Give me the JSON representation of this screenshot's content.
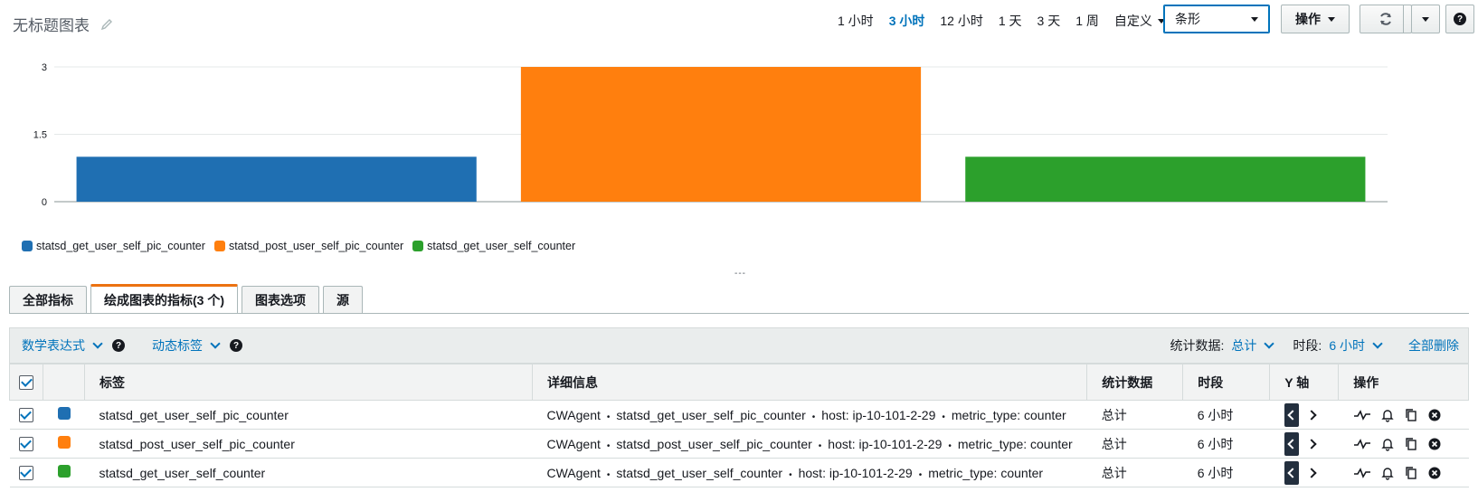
{
  "header": {
    "title": "无标题图表",
    "ranges": [
      {
        "label": "1 小时",
        "active": false
      },
      {
        "label": "3 小时",
        "active": true
      },
      {
        "label": "12 小时",
        "active": false
      },
      {
        "label": "1 天",
        "active": false
      },
      {
        "label": "3 天",
        "active": false
      },
      {
        "label": "1 周",
        "active": false
      }
    ],
    "custom_label": "自定义",
    "chart_type": "条形",
    "actions_label": "操作"
  },
  "chart_data": {
    "type": "bar",
    "categories": [
      "statsd_get_user_self_pic_counter",
      "statsd_post_user_self_pic_counter",
      "statsd_get_user_self_counter"
    ],
    "values": [
      1,
      3,
      1
    ],
    "colors": [
      "#1f6fb2",
      "#ff7f0e",
      "#2ca02c"
    ],
    "ylim": [
      0,
      3
    ],
    "yticks": [
      "0",
      "1.5",
      "3"
    ],
    "grid": true,
    "legend_position": "bottom-left"
  },
  "legend": [
    {
      "label": "statsd_get_user_self_pic_counter",
      "color": "#1f6fb2"
    },
    {
      "label": "statsd_post_user_self_pic_counter",
      "color": "#ff7f0e"
    },
    {
      "label": "statsd_get_user_self_counter",
      "color": "#2ca02c"
    }
  ],
  "resize_handle": "---",
  "tabs": [
    {
      "label": "全部指标",
      "active": false
    },
    {
      "label": "绘成图表的指标(3 个)",
      "active": true
    },
    {
      "label": "图表选项",
      "active": false
    },
    {
      "label": "源",
      "active": false
    }
  ],
  "toolbar": {
    "math_expression": "数学表达式",
    "dynamic_labels": "动态标签",
    "stat_label": "统计数据:",
    "stat_value": "总计",
    "period_label": "时段:",
    "period_value": "6 小时",
    "remove_all": "全部删除"
  },
  "table": {
    "headers": [
      "标签",
      "详细信息",
      "统计数据",
      "时段",
      "Y 轴",
      "操作"
    ],
    "rows": [
      {
        "color": "#1f6fb2",
        "label": "statsd_get_user_self_pic_counter",
        "details": [
          "CWAgent",
          "statsd_get_user_self_pic_counter",
          "host: ip-10-101-2-29",
          "metric_type: counter"
        ],
        "stat": "总计",
        "period": "6 小时"
      },
      {
        "color": "#ff7f0e",
        "label": "statsd_post_user_self_pic_counter",
        "details": [
          "CWAgent",
          "statsd_post_user_self_pic_counter",
          "host: ip-10-101-2-29",
          "metric_type: counter"
        ],
        "stat": "总计",
        "period": "6 小时"
      },
      {
        "color": "#2ca02c",
        "label": "statsd_get_user_self_counter",
        "details": [
          "CWAgent",
          "statsd_get_user_self_counter",
          "host: ip-10-101-2-29",
          "metric_type: counter"
        ],
        "stat": "总计",
        "period": "6 小时"
      }
    ]
  }
}
